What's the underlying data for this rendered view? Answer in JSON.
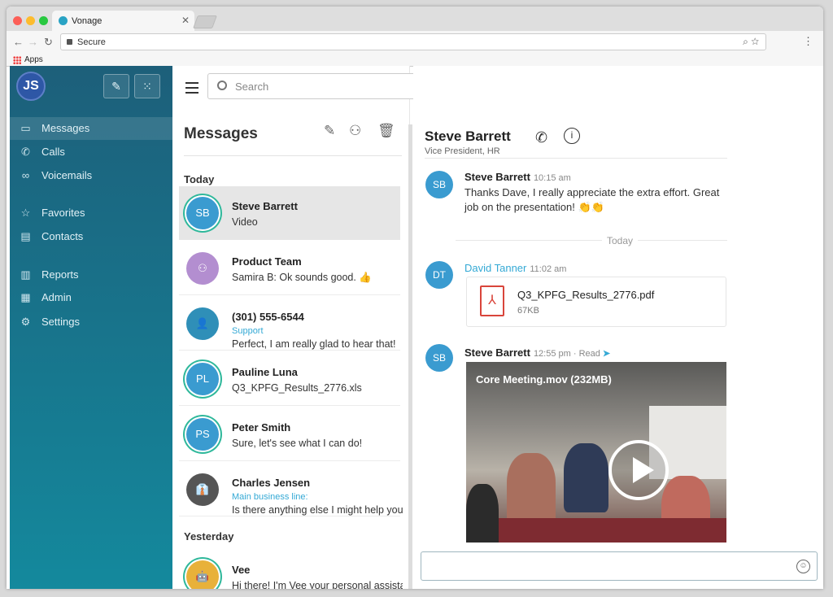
{
  "browser": {
    "tab_title": "Vonage",
    "url_label": "Secure",
    "bookmark": "Apps"
  },
  "sidebar": {
    "user_initials": "JS",
    "items": [
      {
        "label": "Messages",
        "icon": "chat-icon",
        "active": true
      },
      {
        "label": "Calls",
        "icon": "phone-icon"
      },
      {
        "label": "Voicemails",
        "icon": "voicemail-icon"
      },
      {
        "label": "Favorites",
        "icon": "star-icon"
      },
      {
        "label": "Contacts",
        "icon": "contacts-icon"
      },
      {
        "label": "Reports",
        "icon": "reports-icon"
      },
      {
        "label": "Admin",
        "icon": "admin-icon"
      },
      {
        "label": "Settings",
        "icon": "gear-icon"
      }
    ]
  },
  "search": {
    "placeholder": "Search"
  },
  "messages": {
    "title": "Messages",
    "today": "Today",
    "yesterday": "Yesterday",
    "conversations": [
      {
        "initials": "SB",
        "name": "Steve Barrett",
        "sub": "Video",
        "color": "#3a9bd0"
      },
      {
        "initials": "",
        "name": "Product Team",
        "sub": "Samira B: Ok sounds good. 👍",
        "color": "#b38ed0"
      },
      {
        "initials": "",
        "name": "(301) 555-6544",
        "tag": "Support",
        "sub": "Perfect, I am really glad to hear that!",
        "color": "#2f8fb8"
      },
      {
        "initials": "PL",
        "name": "Pauline Luna",
        "sub": "Q3_KPFG_Results_2776.xls",
        "color": "#3a9bd0"
      },
      {
        "initials": "PS",
        "name": "Peter Smith",
        "sub": "Sure, let's see what I can do!",
        "color": "#3a9bd0"
      },
      {
        "initials": "",
        "name": "Charles Jensen",
        "tag": "Main business line:",
        "sub": "Is there anything else I might help you",
        "color": "#555"
      },
      {
        "initials": "",
        "name": "Vee",
        "sub": "Hi there! I'm Vee your personal assistant",
        "color": "#e8b13a"
      }
    ]
  },
  "chat": {
    "name": "Steve Barrett",
    "title": "Vice President, HR",
    "divider": "Today",
    "messages": [
      {
        "initials": "SB",
        "sender": "Steve Barrett",
        "time": "10:15 am",
        "text": "Thanks Dave, I really appreciate the extra effort. Great job on the presentation! 👏👏"
      },
      {
        "initials": "DT",
        "sender": "David Tanner",
        "time": "11:02 am",
        "file_name": "Q3_KPFG_Results_2776.pdf",
        "file_size": "67KB"
      },
      {
        "initials": "SB",
        "sender": "Steve Barrett",
        "time": "12:55 pm · Read",
        "video": "Core Meeting.mov (232MB)"
      }
    ]
  }
}
